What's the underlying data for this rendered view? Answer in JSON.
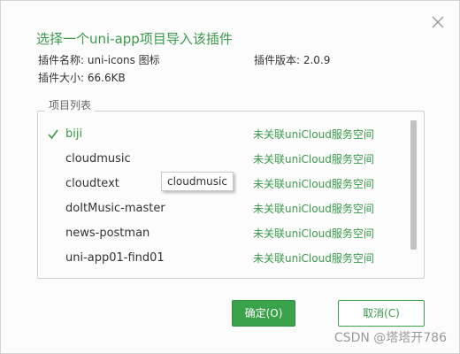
{
  "dialog": {
    "title": "选择一个uni-app项目导入该插件",
    "close_icon": "close-icon"
  },
  "plugin_info": {
    "name_label": "插件名称: uni-icons 图标",
    "version_label": "插件版本: 2.0.9",
    "size_label": "插件大小: 66.6KB"
  },
  "project_list": {
    "legend": "项目列表",
    "items": [
      {
        "name": "biji",
        "status": "未关联uniCloud服务空间",
        "checked": true
      },
      {
        "name": "cloudmusic",
        "status": "未关联uniCloud服务空间",
        "checked": false
      },
      {
        "name": "cloudtext",
        "status": "未关联uniCloud服务空间",
        "checked": false
      },
      {
        "name": "doItMusic-master",
        "status": "未关联uniCloud服务空间",
        "checked": false
      },
      {
        "name": "news-postman",
        "status": "未关联uniCloud服务空间",
        "checked": false
      },
      {
        "name": "uni-app01-find01",
        "status": "未关联uniCloud服务空间",
        "checked": false
      }
    ],
    "tooltip": "cloudmusic"
  },
  "buttons": {
    "ok_label": "确定(O)",
    "cancel_label": "取消(C)"
  },
  "watermark": "CSDN @塔塔开786",
  "colors": {
    "accent": "#3a9a4a",
    "button_green": "#3aa24b"
  }
}
